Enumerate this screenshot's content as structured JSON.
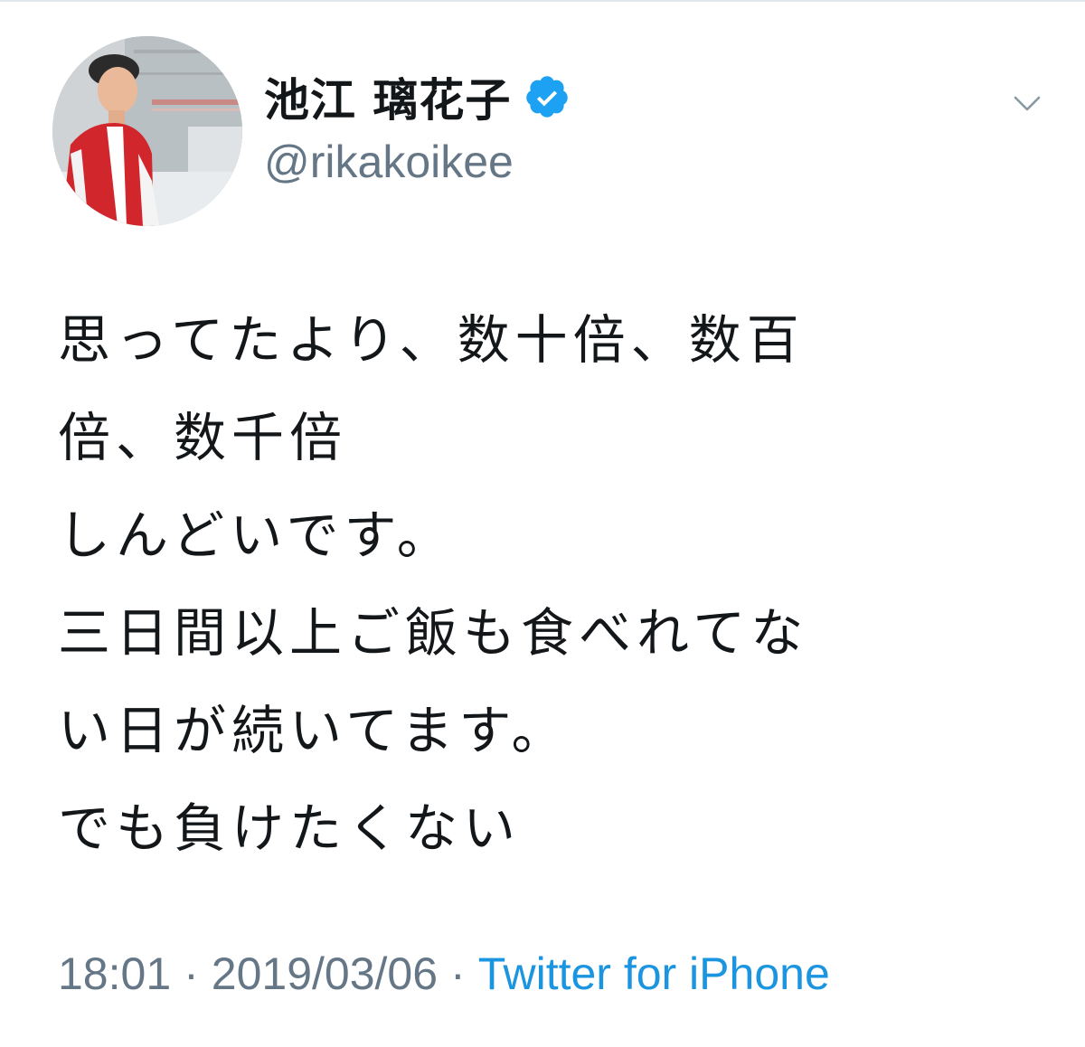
{
  "author": {
    "display_name": "池江 璃花子",
    "handle": "@rikakoikee",
    "verified": true,
    "avatar_icon": "profile-photo"
  },
  "menu": {
    "icon": "chevron-down-icon"
  },
  "tweet": {
    "lines": [
      "思ってたより、数十倍、数百",
      "倍、数千倍",
      "しんどいです。",
      "三日間以上ご飯も食べれてな",
      "い日が続いてます。",
      "でも負けたくない"
    ]
  },
  "meta": {
    "time": "18:01",
    "separator": "·",
    "date": "2019/03/06",
    "source": "Twitter for iPhone"
  },
  "colors": {
    "text": "#14171a",
    "muted": "#657786",
    "link": "#1b95e0",
    "verified_badge": "#1da1f2"
  }
}
